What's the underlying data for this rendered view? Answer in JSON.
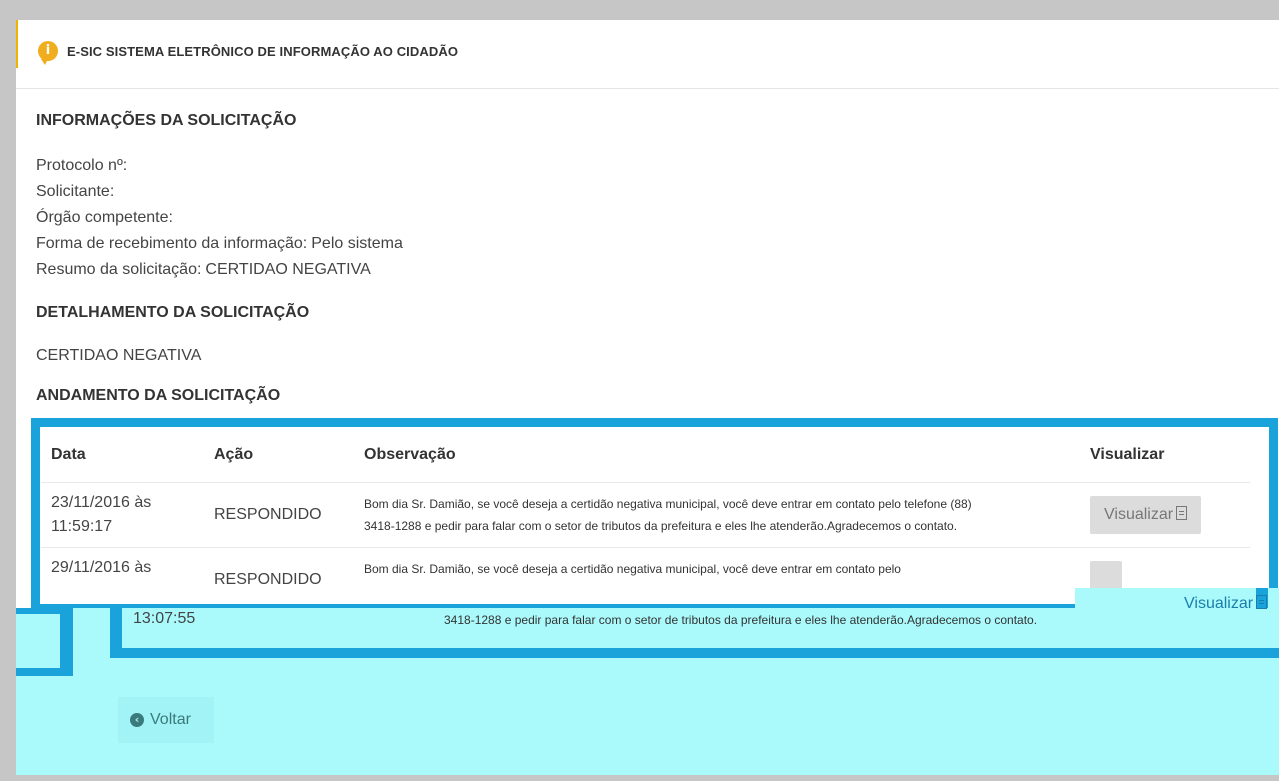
{
  "header": {
    "title": "E-SIC SISTEMA ELETRÔNICO DE INFORMAÇÃO AO CIDADÃO",
    "icon": "info-icon"
  },
  "info_section": {
    "title": "INFORMAÇÕES DA SOLICITAÇÃO",
    "fields": [
      {
        "label": "Protocolo nº:",
        "value": ""
      },
      {
        "label": "Solicitante:",
        "value": ""
      },
      {
        "label": "Órgão competente:",
        "value": ""
      },
      {
        "label": "Forma de recebimento da informação:",
        "value": "Pelo sistema"
      },
      {
        "label": "Resumo da solicitação:",
        "value": "CERTIDAO NEGATIVA"
      }
    ]
  },
  "detail_section": {
    "title": "DETALHAMENTO DA SOLICITAÇÃO",
    "text": "CERTIDAO NEGATIVA"
  },
  "progress_section": {
    "title": "ANDAMENTO DA SOLICITAÇÃO",
    "columns": [
      "Data",
      "Ação",
      "Observação",
      "Visualizar"
    ],
    "rows": [
      {
        "date_line1": "23/11/2016 às",
        "date_line2": "11:59:17",
        "action": "RESPONDIDO",
        "observation_line1": "Bom dia Sr. Damião, se você deseja a certidão negativa municipal, você deve entrar em contato pelo telefone (88)",
        "observation_line2": "3418-1288 e pedir para falar com o setor de tributos da prefeitura e eles lhe atenderão.Agradecemos o contato.",
        "view_label": "Visualizar"
      },
      {
        "date_line1": "29/11/2016 às",
        "date_line2": "13:07:55",
        "action": "RESPONDIDO",
        "observation_line1": "Bom dia Sr. Damião, se você deseja a certidão negativa municipal, você deve entrar em contato pelo",
        "observation_line2": "3418-1288 e pedir para falar com o setor de tributos da prefeitura e eles lhe atenderão.Agradecemos o contato.",
        "view_label": "Visualizar"
      }
    ]
  },
  "back_button": {
    "label": "Voltar"
  },
  "colors": {
    "accent_blue": "#1aa2db",
    "header_icon": "#f0ad1e",
    "glitch_cyan": "#aaf9fb"
  }
}
